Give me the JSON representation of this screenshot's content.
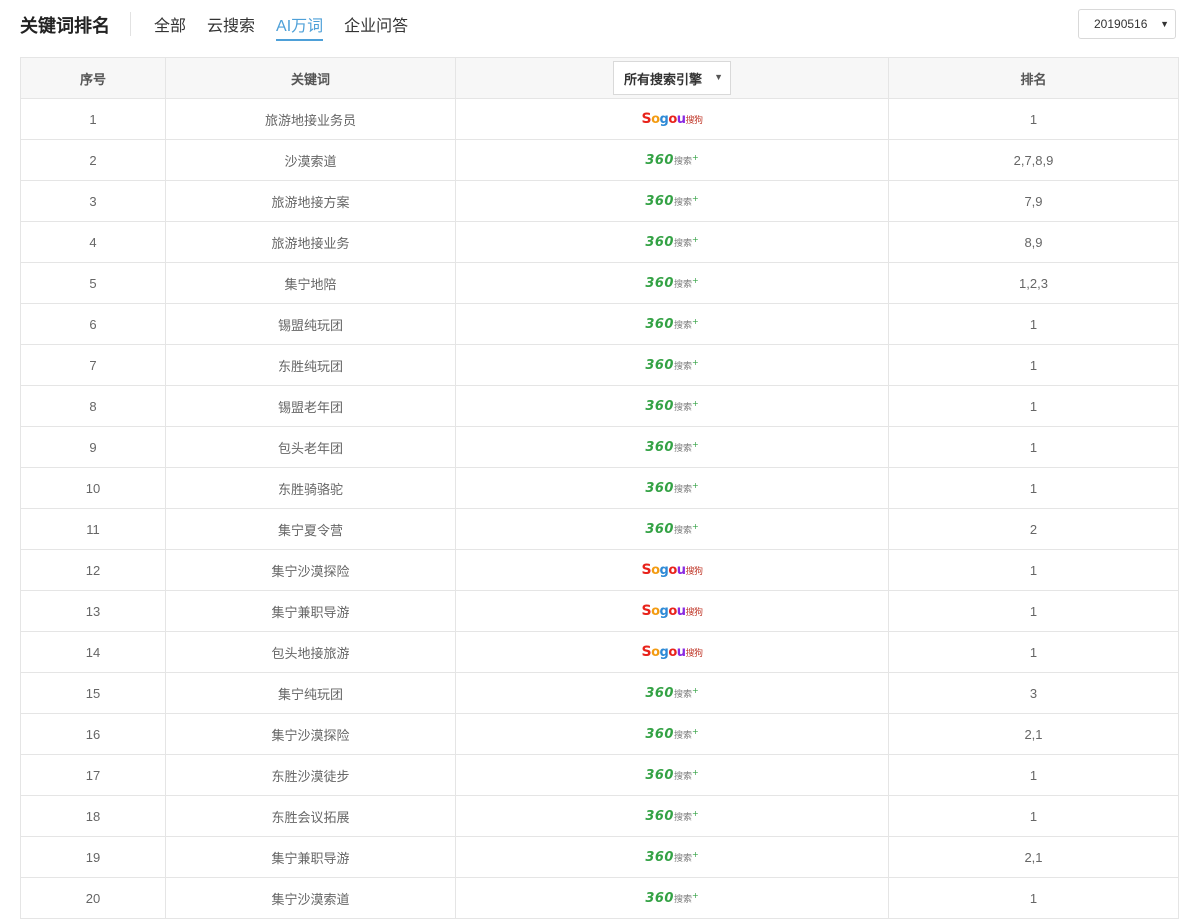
{
  "header": {
    "title": "关键词排名",
    "tabs": [
      {
        "label": "全部",
        "active": false
      },
      {
        "label": "云搜索",
        "active": false
      },
      {
        "label": "AI万词",
        "active": true
      },
      {
        "label": "企业问答",
        "active": false
      }
    ],
    "date_select": {
      "value": "20190516"
    }
  },
  "table": {
    "columns": [
      "序号",
      "关键词",
      "所有搜索引擎",
      "排名"
    ],
    "engine_filter": {
      "value": "所有搜索引擎"
    },
    "engine_logos": {
      "360": {
        "icon": "360-search-logo",
        "num": "360",
        "text": "搜索",
        "plus": "+"
      },
      "sogou": {
        "icon": "sogou-logo",
        "letters": [
          "S",
          "o",
          "g",
          "o",
          "u"
        ],
        "text": "搜狗"
      }
    },
    "rows": [
      {
        "index": "1",
        "keyword": "旅游地接业务员",
        "engine": "sogou",
        "rank": "1"
      },
      {
        "index": "2",
        "keyword": "沙漠索道",
        "engine": "360",
        "rank": "2,7,8,9"
      },
      {
        "index": "3",
        "keyword": "旅游地接方案",
        "engine": "360",
        "rank": "7,9"
      },
      {
        "index": "4",
        "keyword": "旅游地接业务",
        "engine": "360",
        "rank": "8,9"
      },
      {
        "index": "5",
        "keyword": "集宁地陪",
        "engine": "360",
        "rank": "1,2,3"
      },
      {
        "index": "6",
        "keyword": "锡盟纯玩团",
        "engine": "360",
        "rank": "1"
      },
      {
        "index": "7",
        "keyword": "东胜纯玩团",
        "engine": "360",
        "rank": "1"
      },
      {
        "index": "8",
        "keyword": "锡盟老年团",
        "engine": "360",
        "rank": "1"
      },
      {
        "index": "9",
        "keyword": "包头老年团",
        "engine": "360",
        "rank": "1"
      },
      {
        "index": "10",
        "keyword": "东胜骑骆驼",
        "engine": "360",
        "rank": "1"
      },
      {
        "index": "11",
        "keyword": "集宁夏令营",
        "engine": "360",
        "rank": "2"
      },
      {
        "index": "12",
        "keyword": "集宁沙漠探险",
        "engine": "sogou",
        "rank": "1"
      },
      {
        "index": "13",
        "keyword": "集宁兼职导游",
        "engine": "sogou",
        "rank": "1"
      },
      {
        "index": "14",
        "keyword": "包头地接旅游",
        "engine": "sogou",
        "rank": "1"
      },
      {
        "index": "15",
        "keyword": "集宁纯玩团",
        "engine": "360",
        "rank": "3"
      },
      {
        "index": "16",
        "keyword": "集宁沙漠探险",
        "engine": "360",
        "rank": "2,1"
      },
      {
        "index": "17",
        "keyword": "东胜沙漠徒步",
        "engine": "360",
        "rank": "1"
      },
      {
        "index": "18",
        "keyword": "东胜会议拓展",
        "engine": "360",
        "rank": "1"
      },
      {
        "index": "19",
        "keyword": "集宁兼职导游",
        "engine": "360",
        "rank": "2,1"
      },
      {
        "index": "20",
        "keyword": "集宁沙漠索道",
        "engine": "360",
        "rank": "1"
      }
    ]
  }
}
